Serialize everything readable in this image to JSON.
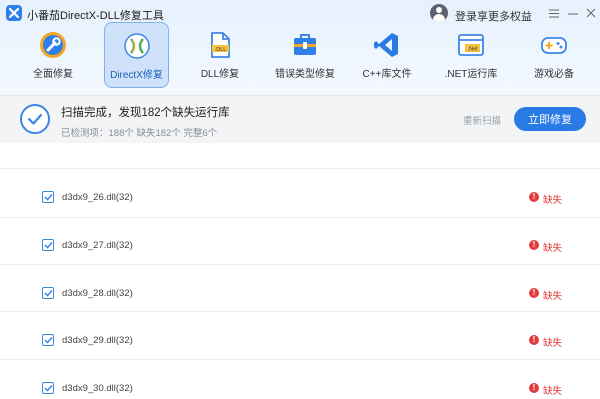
{
  "app": {
    "title": "小番茄DirectX-DLL修复工具"
  },
  "account": {
    "login_text": "登录享更多权益"
  },
  "window_controls": {
    "menu": "menu-icon",
    "minimize": "minimize-icon",
    "close": "close-icon"
  },
  "nav": {
    "items": [
      {
        "label": "全面修复",
        "icon": "wrench-icon"
      },
      {
        "label": "DirectX修复",
        "icon": "directx-icon",
        "active": true
      },
      {
        "label": "DLL修复",
        "icon": "dll-file-icon",
        "badge": ".DLL"
      },
      {
        "label": "错误类型修复",
        "icon": "toolbox-icon"
      },
      {
        "label": "C++库文件",
        "icon": "code-icon"
      },
      {
        "label": ".NET运行库",
        "icon": "dotnet-window-icon",
        "badge": ".Net"
      },
      {
        "label": "游戏必备",
        "icon": "gamepad-icon"
      }
    ]
  },
  "status": {
    "title": "扫描完成，发现182个缺失运行库",
    "detail": "已检测项：188个 缺失182个 完整6个",
    "rescan": "重新扫描",
    "fix_button": "立即修复"
  },
  "list": {
    "items": [
      {
        "name": "d3dx9_26.dll(32)",
        "status": "缺失",
        "checked": true
      },
      {
        "name": "d3dx9_27.dll(32)",
        "status": "缺失",
        "checked": true
      },
      {
        "name": "d3dx9_28.dll(32)",
        "status": "缺失",
        "checked": true
      },
      {
        "name": "d3dx9_29.dll(32)",
        "status": "缺失",
        "checked": true
      },
      {
        "name": "d3dx9_30.dll(32)",
        "status": "缺失",
        "checked": true
      }
    ]
  },
  "colors": {
    "accent": "#2a7ae6",
    "error": "#e23b3b",
    "active_nav_bg": "#cfe2f9"
  }
}
